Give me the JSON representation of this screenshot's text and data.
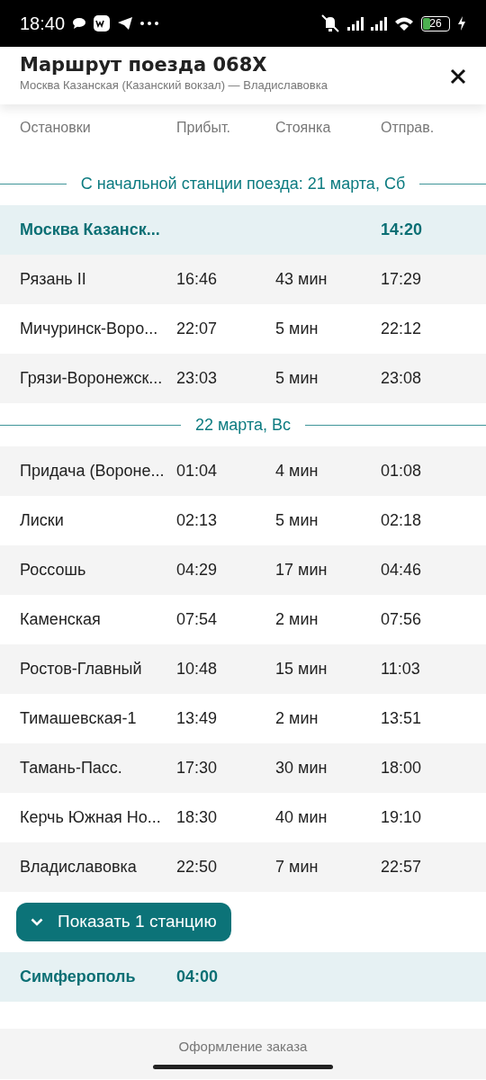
{
  "status_bar": {
    "time": "18:40",
    "battery": "26"
  },
  "header": {
    "title": "Маршрут поезда 068Х",
    "subtitle": "Москва Казанская (Казанский вокзал) — Владиславовка"
  },
  "columns": [
    "Остановки",
    "Прибыт.",
    "Стоянка",
    "Отправ."
  ],
  "groups": [
    {
      "date": "С начальной станции поезда: 21 марта, Сб",
      "rows": [
        {
          "kind": "terminal",
          "station": "Москва Казанск...",
          "departure": "14:20"
        },
        {
          "kind": "stop",
          "station": "Рязань II",
          "arrival": "16:46",
          "stop": "43 мин",
          "departure": "17:29"
        },
        {
          "kind": "stop",
          "station": "Мичуринск-Воро...",
          "arrival": "22:07",
          "stop": "5 мин",
          "departure": "22:12"
        },
        {
          "kind": "stop",
          "station": "Грязи-Воронежск...",
          "arrival": "23:03",
          "stop": "5 мин",
          "departure": "23:08"
        }
      ]
    },
    {
      "date": "22 марта, Вс",
      "rows": [
        {
          "kind": "stop",
          "station": "Придача (Вороне...",
          "arrival": "01:04",
          "stop": "4 мин",
          "departure": "01:08"
        },
        {
          "kind": "stop",
          "station": "Лиски",
          "arrival": "02:13",
          "stop": "5 мин",
          "departure": "02:18"
        },
        {
          "kind": "stop",
          "station": "Россошь",
          "arrival": "04:29",
          "stop": "17 мин",
          "departure": "04:46"
        },
        {
          "kind": "stop",
          "station": "Каменская",
          "arrival": "07:54",
          "stop": "2 мин",
          "departure": "07:56"
        },
        {
          "kind": "stop",
          "station": "Ростов-Главный",
          "arrival": "10:48",
          "stop": "15 мин",
          "departure": "11:03"
        },
        {
          "kind": "stop",
          "station": "Тимашевская-1",
          "arrival": "13:49",
          "stop": "2 мин",
          "departure": "13:51"
        },
        {
          "kind": "stop",
          "station": "Тамань-Пасс.",
          "arrival": "17:30",
          "stop": "30 мин",
          "departure": "18:00"
        },
        {
          "kind": "stop",
          "station": "Керчь Южная Но...",
          "arrival": "18:30",
          "stop": "40 мин",
          "departure": "19:10"
        },
        {
          "kind": "stop",
          "station": "Владиславовка",
          "arrival": "22:50",
          "stop": "7 мин",
          "departure": "22:57"
        }
      ]
    }
  ],
  "show_more": "Показать 1 станцию",
  "final_row": {
    "kind": "terminal",
    "station": "Симферополь",
    "arrival": "04:00"
  },
  "footer": "Оформление заказа"
}
